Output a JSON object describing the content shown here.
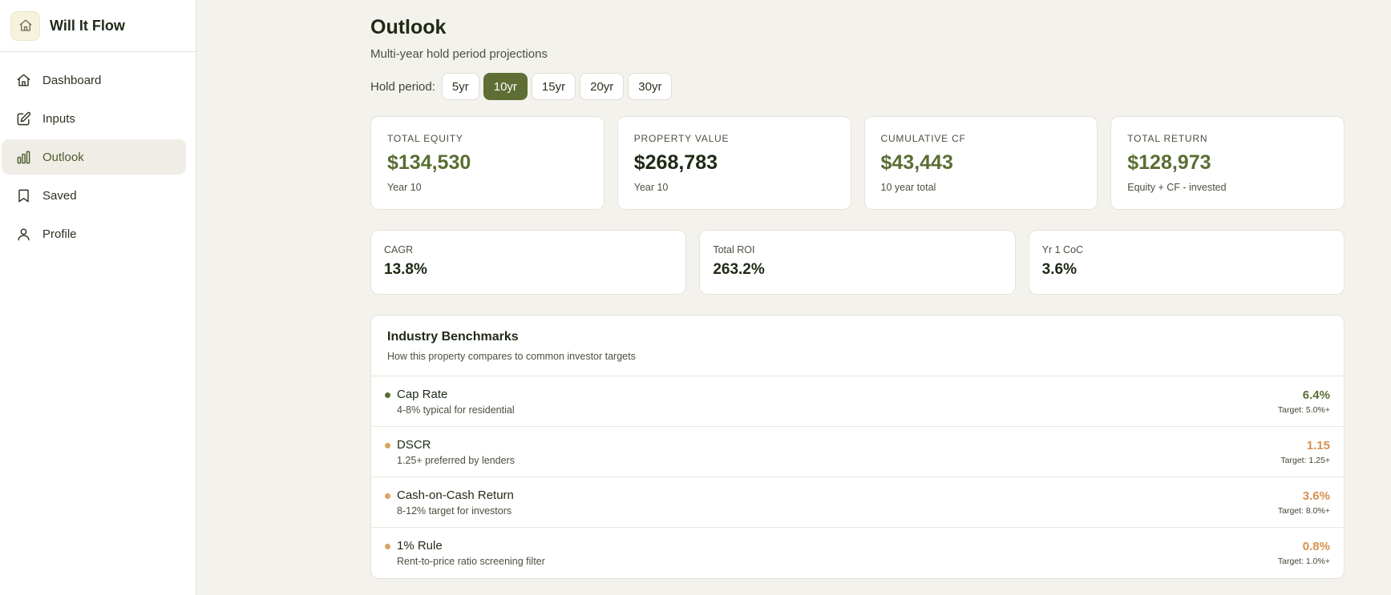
{
  "app": {
    "name": "Will It Flow"
  },
  "sidebar": {
    "items": [
      {
        "label": "Dashboard",
        "icon": "home-icon"
      },
      {
        "label": "Inputs",
        "icon": "edit-icon"
      },
      {
        "label": "Outlook",
        "icon": "bar-chart-icon",
        "active": true
      },
      {
        "label": "Saved",
        "icon": "bookmark-icon"
      },
      {
        "label": "Profile",
        "icon": "user-icon"
      }
    ]
  },
  "page": {
    "title": "Outlook",
    "subtitle": "Multi-year hold period projections"
  },
  "hold": {
    "label": "Hold period:",
    "options": [
      "5yr",
      "10yr",
      "15yr",
      "20yr",
      "30yr"
    ],
    "selected": "10yr"
  },
  "kpis": [
    {
      "label": "TOTAL EQUITY",
      "value": "$134,530",
      "sub": "Year 10"
    },
    {
      "label": "PROPERTY VALUE",
      "value": "$268,783",
      "sub": "Year 10"
    },
    {
      "label": "CUMULATIVE CF",
      "value": "$43,443",
      "sub": "10 year total"
    },
    {
      "label": "TOTAL RETURN",
      "value": "$128,973",
      "sub": "Equity + CF - invested"
    }
  ],
  "metrics": [
    {
      "label": "CAGR",
      "value": "13.8%"
    },
    {
      "label": "Total ROI",
      "value": "263.2%"
    },
    {
      "label": "Yr 1 CoC",
      "value": "3.6%"
    }
  ],
  "benchmarks": {
    "title": "Industry Benchmarks",
    "description": "How this property compares to common investor targets",
    "rows": [
      {
        "name": "Cap Rate",
        "hint": "4-8% typical for residential",
        "value": "6.4%",
        "target": "Target: 5.0%+"
      },
      {
        "name": "DSCR",
        "hint": "1.25+ preferred by lenders",
        "value": "1.15",
        "target": "Target: 1.25+"
      },
      {
        "name": "Cash-on-Cash Return",
        "hint": "8-12% target for investors",
        "value": "3.6%",
        "target": "Target: 8.0%+"
      },
      {
        "name": "1% Rule",
        "hint": "Rent-to-price ratio screening filter",
        "value": "0.8%",
        "target": "Target: 1.0%+"
      }
    ]
  },
  "colors": {
    "accent": "#5e6e35",
    "good": "#5a6e33",
    "warn": "#d9914f",
    "warn_dot": "#d8a35f",
    "good_dot": "#5a6e33"
  }
}
